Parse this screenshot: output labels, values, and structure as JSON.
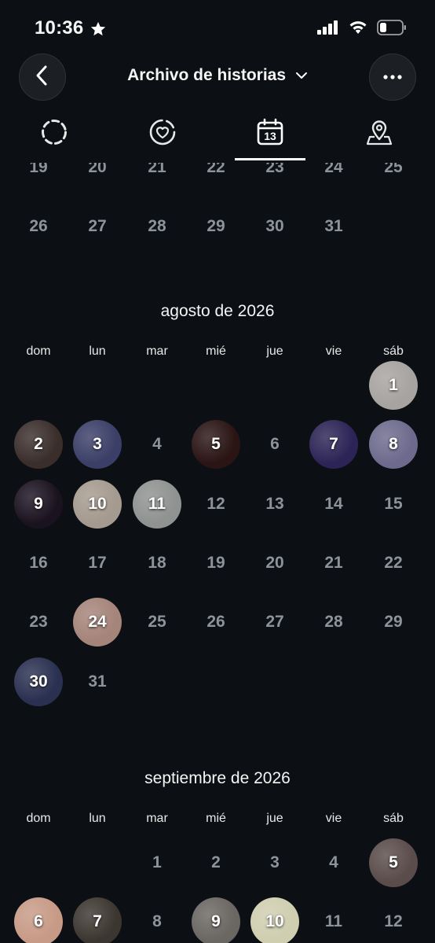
{
  "status_bar": {
    "time": "10:36"
  },
  "header": {
    "title": "Archivo de historias"
  },
  "tabs": [
    {
      "name": "tab-stories",
      "icon": "dashed-circle-icon"
    },
    {
      "name": "tab-highlights",
      "icon": "heart-circle-icon"
    },
    {
      "name": "tab-calendar",
      "icon": "calendar-13-icon",
      "text": "13",
      "active": true
    },
    {
      "name": "tab-map",
      "icon": "map-pin-icon"
    }
  ],
  "weekdays": [
    "dom",
    "lun",
    "mar",
    "mié",
    "jue",
    "vie",
    "sáb"
  ],
  "months": [
    {
      "title": "",
      "weeks": [
        [
          {
            "d": "19"
          },
          {
            "d": "20"
          },
          {
            "d": "21"
          },
          {
            "d": "22"
          },
          {
            "d": "23"
          },
          {
            "d": "24"
          },
          {
            "d": "25"
          }
        ],
        [
          {
            "d": "26"
          },
          {
            "d": "27"
          },
          {
            "d": "28"
          },
          {
            "d": "29"
          },
          {
            "d": "30"
          },
          {
            "d": "31"
          },
          null
        ]
      ]
    },
    {
      "title": "agosto de 2026",
      "weeks": [
        [
          null,
          null,
          null,
          null,
          null,
          null,
          {
            "d": "1",
            "story": true,
            "bg": "#a7a3a0"
          }
        ],
        [
          {
            "d": "2",
            "story": true,
            "bg": "#3a2e2b"
          },
          {
            "d": "3",
            "story": true,
            "bg": "#3b3f67"
          },
          {
            "d": "4"
          },
          {
            "d": "5",
            "story": true,
            "bg": "#2a1414"
          },
          {
            "d": "6"
          },
          {
            "d": "7",
            "story": true,
            "bg": "#2c2456"
          },
          {
            "d": "8",
            "story": true,
            "bg": "#6e6a8d"
          }
        ],
        [
          {
            "d": "9",
            "story": true,
            "bg": "#1b1220"
          },
          {
            "d": "10",
            "story": true,
            "bg": "#a59a8f"
          },
          {
            "d": "11",
            "story": true,
            "bg": "#8f9290"
          },
          {
            "d": "12"
          },
          {
            "d": "13"
          },
          {
            "d": "14"
          },
          {
            "d": "15"
          }
        ],
        [
          {
            "d": "16"
          },
          {
            "d": "17"
          },
          {
            "d": "18"
          },
          {
            "d": "19"
          },
          {
            "d": "20"
          },
          {
            "d": "21"
          },
          {
            "d": "22"
          }
        ],
        [
          {
            "d": "23"
          },
          {
            "d": "24",
            "story": true,
            "bg": "#a5847a"
          },
          {
            "d": "25"
          },
          {
            "d": "26"
          },
          {
            "d": "27"
          },
          {
            "d": "28"
          },
          {
            "d": "29"
          }
        ],
        [
          {
            "d": "30",
            "story": true,
            "bg": "#2a3050"
          },
          {
            "d": "31"
          },
          null,
          null,
          null,
          null,
          null
        ]
      ]
    },
    {
      "title": "septiembre de 2026",
      "weeks": [
        [
          null,
          null,
          {
            "d": "1"
          },
          {
            "d": "2"
          },
          {
            "d": "3"
          },
          {
            "d": "4"
          },
          {
            "d": "5",
            "story": true,
            "bg": "#5a4c4a"
          }
        ],
        [
          {
            "d": "6",
            "story": true,
            "bg": "#c79a86"
          },
          {
            "d": "7",
            "story": true,
            "bg": "#3c3630"
          },
          {
            "d": "8"
          },
          {
            "d": "9",
            "story": true,
            "bg": "#6a6662"
          },
          {
            "d": "10",
            "story": true,
            "bg": "#cfceb0"
          },
          {
            "d": "11"
          },
          {
            "d": "12"
          }
        ]
      ]
    }
  ]
}
